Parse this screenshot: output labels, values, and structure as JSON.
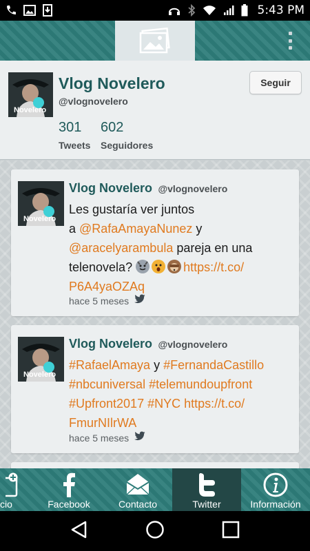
{
  "status_bar": {
    "time": "5:43 PM"
  },
  "profile": {
    "name": "Vlog Novelero",
    "handle": "@vlognovelero",
    "avatar_text": "Novelero",
    "follow_label": "Seguir",
    "tweets_count": "301",
    "tweets_label": "Tweets",
    "followers_count": "602",
    "followers_label": "Seguidores"
  },
  "tweets": [
    {
      "name": "Vlog Novelero",
      "handle": "@vlognovelero",
      "avatar_text": "Novelero",
      "time": "hace 5 meses",
      "line1": "Les gustaría ver juntos",
      "line2_pre": "a ",
      "mention1": "@RafaAmayaNunez",
      "line2_post": " y",
      "mention2": "@aracelyarambula",
      "line3_post": " pareja en una",
      "line4_pre": "telenovela? ",
      "link_part1": "https://t.co/",
      "link_part2": "P6A4yaOZAq"
    },
    {
      "name": "Vlog Novelero",
      "handle": "@vlognovelero",
      "avatar_text": "Novelero",
      "time": "hace 5 meses",
      "tag1": "#RafaelAmaya",
      "joiner": " y ",
      "tag2": "#FernandaCastillo",
      "tag3": "#nbcuniversal",
      "tag4": "#telemundoupfront",
      "tag5": "#Upfront2017",
      "tag6": "#NYC",
      "link_part1": "https://t.co/",
      "link_part2": "FmurNIlrWA"
    }
  ],
  "tabs": [
    {
      "label": "cio",
      "icon": "contact-card-plus-icon"
    },
    {
      "label": "Facebook",
      "icon": "facebook-icon"
    },
    {
      "label": "Contacto",
      "icon": "envelope-icon"
    },
    {
      "label": "Twitter",
      "icon": "twitter-t-icon"
    },
    {
      "label": "Información",
      "icon": "info-icon"
    }
  ],
  "colors": {
    "brand_teal": "#2e7d7a",
    "name_teal": "#1f5a5a",
    "link_orange": "#e07a1f"
  }
}
